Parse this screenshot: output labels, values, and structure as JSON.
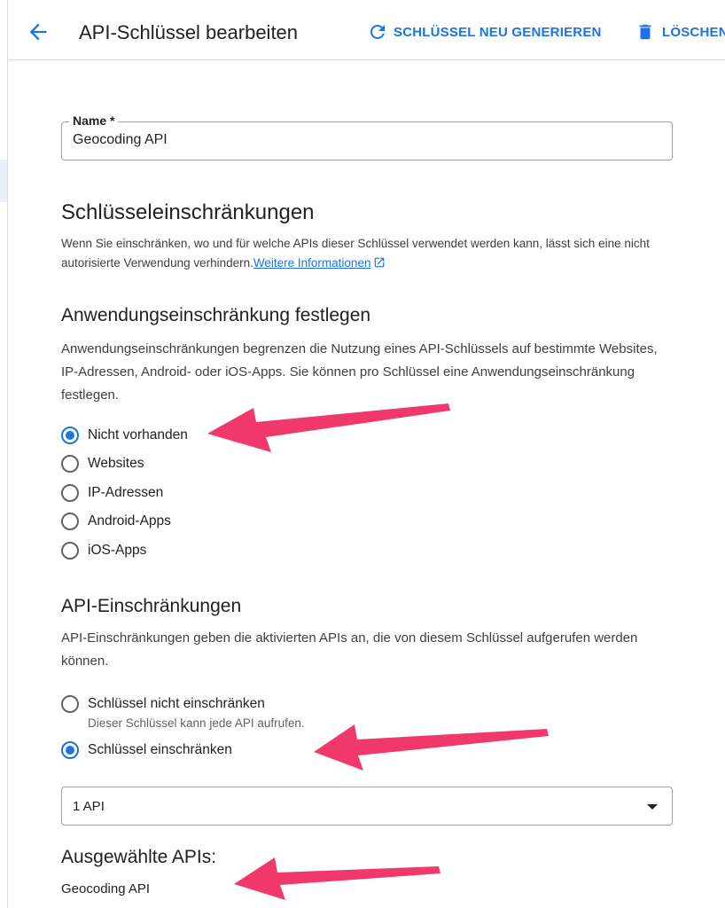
{
  "header": {
    "title": "API-Schlüssel bearbeiten",
    "regenerate_label": "SCHLÜSSEL NEU GENERIEREN",
    "delete_label": "LÖSCHEN"
  },
  "name_field": {
    "label": "Name *",
    "value": "Geocoding API"
  },
  "key_restrictions": {
    "heading": "Schlüsseleinschränkungen",
    "description": "Wenn Sie einschränken, wo und für welche APIs dieser Schlüssel verwendet werden kann, lässt sich eine nicht autorisierte Verwendung verhindern.",
    "link_text": "Weitere Informationen"
  },
  "application_restriction": {
    "heading": "Anwendungseinschränkung festlegen",
    "description": "Anwendungseinschränkungen begrenzen die Nutzung eines API-Schlüssels auf bestimmte Websites, IP-Adressen, Android- oder iOS-Apps. Sie können pro Schlüssel eine Anwendungseinschränkung festlegen.",
    "options": [
      {
        "label": "Nicht vorhanden",
        "checked": true
      },
      {
        "label": "Websites",
        "checked": false
      },
      {
        "label": "IP-Adressen",
        "checked": false
      },
      {
        "label": "Android-Apps",
        "checked": false
      },
      {
        "label": "iOS-Apps",
        "checked": false
      }
    ]
  },
  "api_restrictions": {
    "heading": "API-Einschränkungen",
    "description": "API-Einschränkungen geben die aktivierten APIs an, die von diesem Schlüssel aufgerufen werden können.",
    "options": [
      {
        "label": "Schlüssel nicht einschränken",
        "hint": "Dieser Schlüssel kann jede API aufrufen.",
        "checked": false
      },
      {
        "label": "Schlüssel einschränken",
        "checked": true
      }
    ],
    "select_value": "1 API"
  },
  "selected_apis": {
    "heading": "Ausgewählte APIs:",
    "items": [
      "Geocoding API"
    ]
  },
  "colors": {
    "accent": "#1a73e8",
    "annotation_arrow": "#f0386b"
  }
}
